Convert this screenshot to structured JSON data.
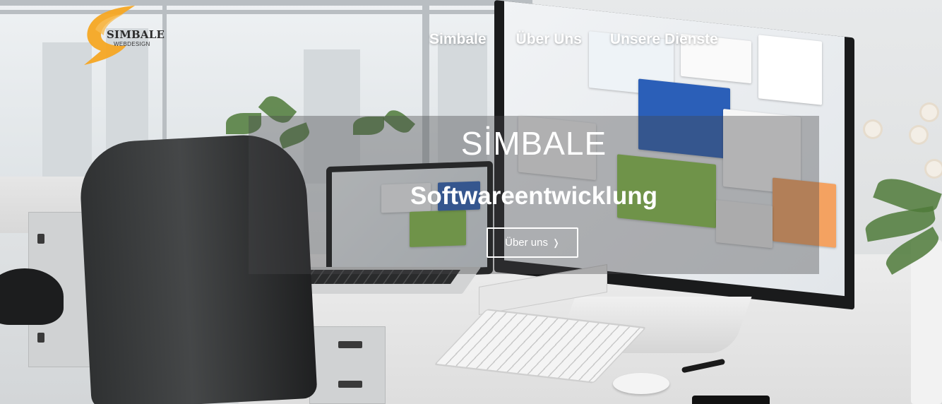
{
  "brand": {
    "logo_title": "SIMBALE",
    "logo_subtitle": "WEBDESIGN",
    "accent_color": "#f5a623"
  },
  "nav": {
    "items": [
      {
        "label": "Simbale"
      },
      {
        "label": "Über Uns"
      },
      {
        "label": "Unsere Dienste"
      }
    ]
  },
  "hero": {
    "title": "SİMBALE",
    "subtitle": "Softwareentwicklung",
    "button_label": "Über uns",
    "button_icon": "chevron-right-icon"
  }
}
